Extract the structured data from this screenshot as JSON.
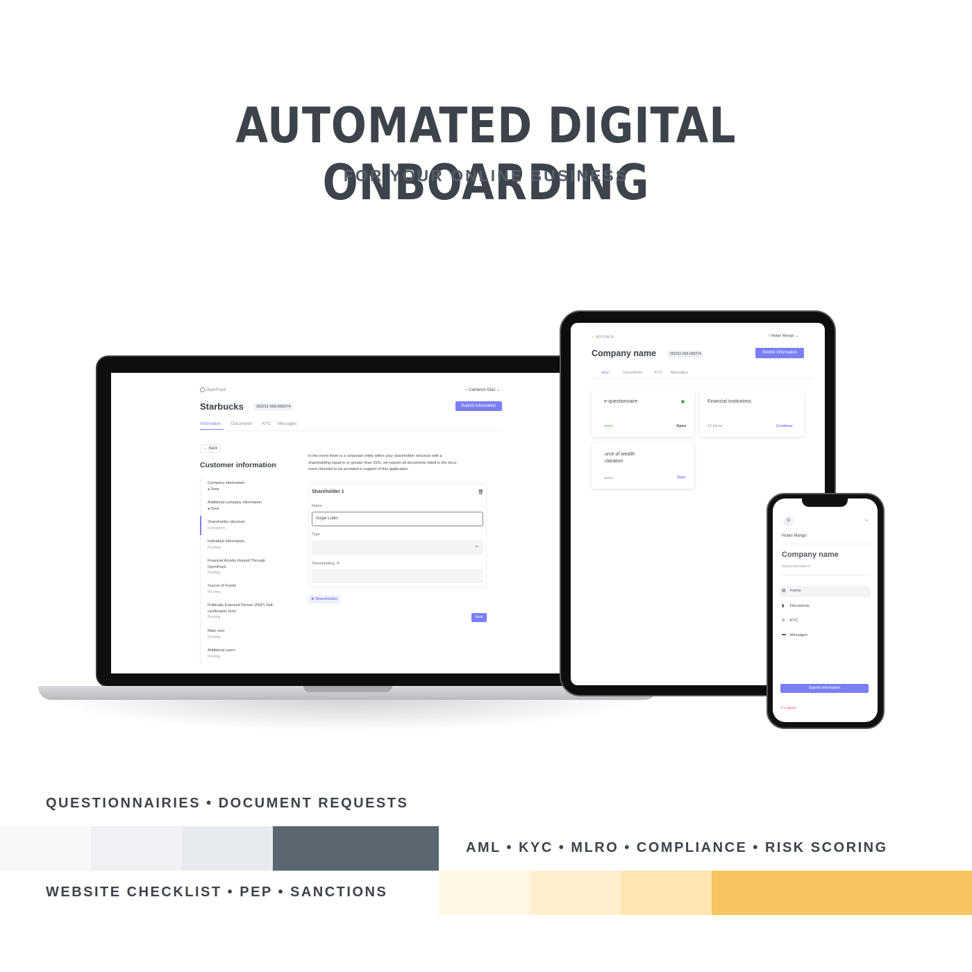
{
  "hero": {
    "title": "AUTOMATED DIGITAL ONBOARDING",
    "subtitle": "FOR YOUR ONLINE BUSINESS"
  },
  "laptop": {
    "brand": "OpenPayd",
    "user": "Cameron Diaz",
    "company": "Starbucks",
    "company_id": "202211-003-000274",
    "submit_label": "Submit information",
    "tabs": [
      "Information",
      "Documents",
      "KYC",
      "Messages"
    ],
    "back_label": "back",
    "section_title": "Customer information",
    "steps": [
      {
        "label": "Company information",
        "status": "Done"
      },
      {
        "label": "Additional company information",
        "status": "Done"
      },
      {
        "label": "Shareholder structure",
        "status": "In progress"
      },
      {
        "label": "Individual Information",
        "status": "Pending"
      },
      {
        "label": "Financial Activity Routed Through",
        "label2": "OpenPayd",
        "status": "Pending"
      },
      {
        "label": "Source of Funds",
        "status": "Pending"
      },
      {
        "label": "Politically Exposed Person (PEP) Self-",
        "label2": "certification form",
        "status": "Pending"
      },
      {
        "label": "Main user",
        "status": "Pending"
      },
      {
        "label": "Additional users",
        "status": "Pending"
      }
    ],
    "intro_lines": [
      "In the event there is a corporate entity within your shareholder structure with a",
      "shareholding equal to or greater than 25%, we require all documents listed in the docu-",
      "ment checklist to be provided in support of this application."
    ],
    "shareholder_title": "Shareholder 1",
    "name_label": "Name",
    "name_value": "Angel Lubin",
    "type_label": "Type",
    "shareholding_label": "Shareholding, %",
    "add_shareholder_label": "Shareholder",
    "next_label": "Next"
  },
  "tablet": {
    "brand": "SKYSTACK",
    "user": "Nolan Mango",
    "company": "Company name",
    "company_id": "202211-003-000274",
    "submit_label": "Submit information",
    "tabs": [
      "ation",
      "Documents",
      "KYC",
      "Messages"
    ],
    "cards": [
      {
        "title": "e-questionnaire",
        "meta": "orms",
        "action": "Open"
      },
      {
        "title": "Financial institutions",
        "meta": "12 forms",
        "action": "Continue"
      },
      {
        "title": "urce of wealth",
        "title2": "claration",
        "meta": "orms",
        "action": "Start"
      }
    ]
  },
  "phone": {
    "avatar": "O",
    "user": "Nolan Mango",
    "company": "Company name",
    "company_id": "202211-003-000274",
    "menu": [
      "Forms",
      "Documents",
      "KYC",
      "Messages"
    ],
    "submit_label": "Submit information",
    "logout_label": "Logout"
  },
  "tags": {
    "line1": "QUESTIONNAIRIES • DOCUMENT REQUESTS",
    "line2": "AML • KYC • MLRO • COMPLIANCE • RISK SCORING",
    "line3": "WEBSITE CHECKLIST • PEP • SANCTIONS"
  },
  "colors": {
    "accent": "#7b7ff5",
    "done": "#4caf50",
    "swatches_gray": [
      "#f6f8fa",
      "#eff1f4",
      "#e7eaee",
      "#5a6670"
    ],
    "swatches_yellow": [
      "#fff6e6",
      "#ffefcf",
      "#fde6b1",
      "#f6c55e"
    ]
  }
}
